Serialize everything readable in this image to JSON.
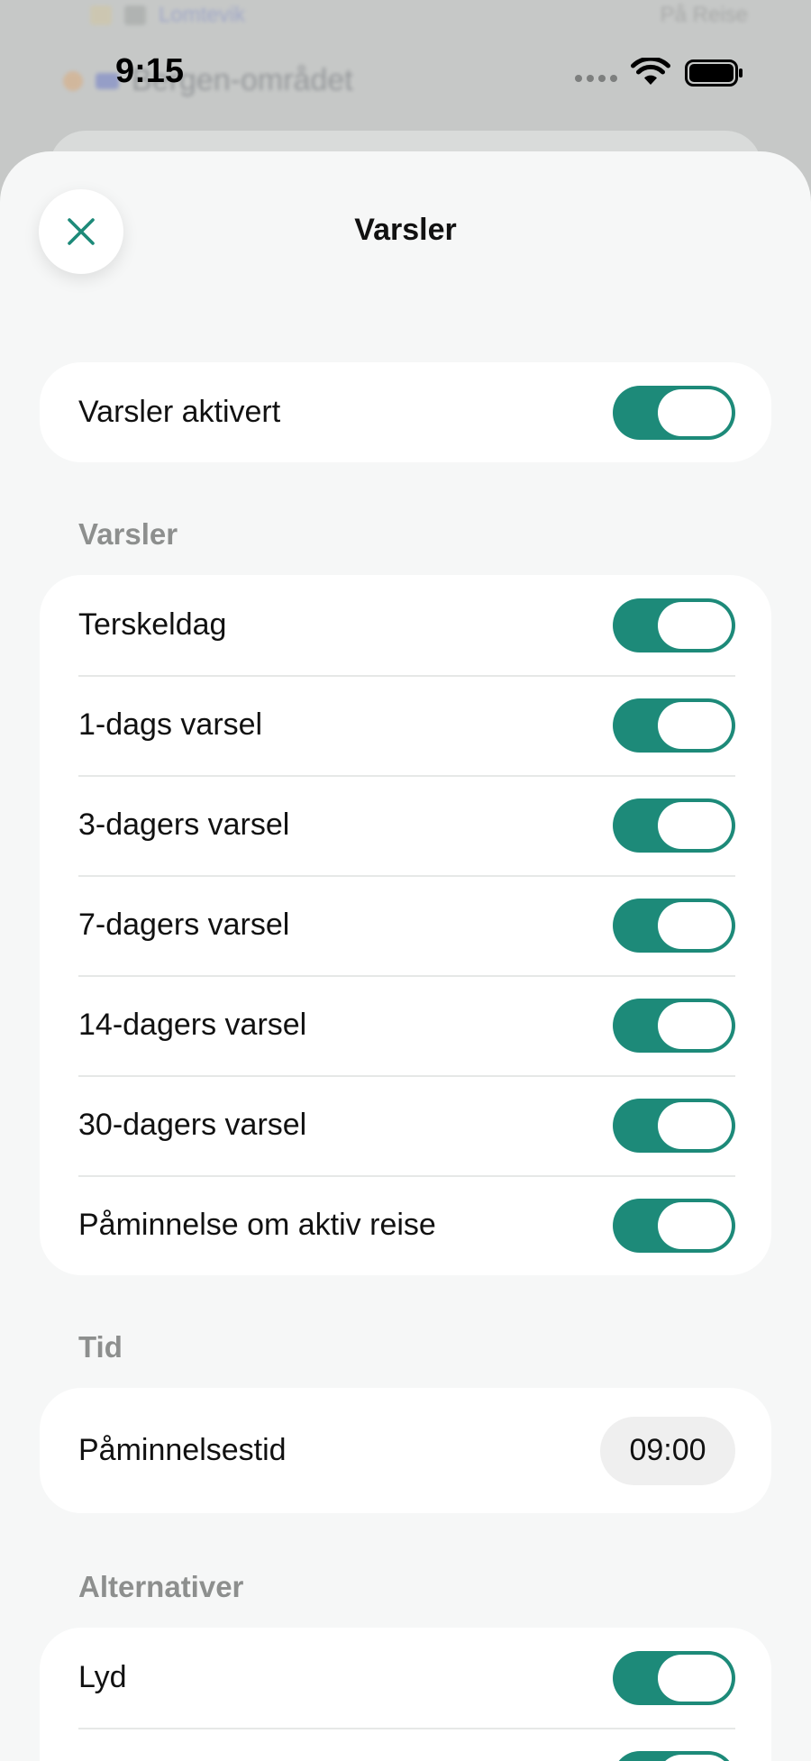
{
  "background": {
    "row1_text": "Lomtevik",
    "row1_right": "På Reise",
    "row2_text": "Bergen-området"
  },
  "status_bar": {
    "time": "9:15"
  },
  "sheet": {
    "title": "Varsler",
    "master": {
      "label": "Varsler aktivert",
      "enabled": true
    },
    "sections": {
      "alerts": {
        "header": "Varsler",
        "items": [
          {
            "label": "Terskeldag",
            "enabled": true
          },
          {
            "label": "1-dags varsel",
            "enabled": true
          },
          {
            "label": "3-dagers varsel",
            "enabled": true
          },
          {
            "label": "7-dagers varsel",
            "enabled": true
          },
          {
            "label": "14-dagers varsel",
            "enabled": true
          },
          {
            "label": "30-dagers varsel",
            "enabled": true
          },
          {
            "label": "Påminnelse om aktiv reise",
            "enabled": true
          }
        ]
      },
      "time": {
        "header": "Tid",
        "reminder_label": "Påminnelsestid",
        "reminder_value": "09:00"
      },
      "options": {
        "header": "Alternativer",
        "items": [
          {
            "label": "Lyd",
            "enabled": true
          }
        ]
      }
    }
  },
  "colors": {
    "accent": "#1d8a79",
    "sheet_bg": "#f6f7f7",
    "group_bg": "#ffffff",
    "section_header": "#8d8f8e"
  }
}
